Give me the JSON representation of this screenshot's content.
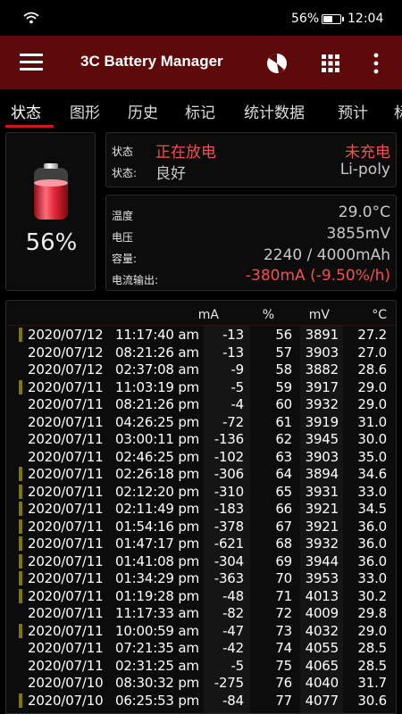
{
  "status_bar": {
    "battery_percent": "56%",
    "time": "12:04",
    "wifi_icon": "wifi-icon",
    "battery_icon": "battery-icon"
  },
  "appbar": {
    "title": "3C Battery Manager",
    "icons": [
      "menu-icon",
      "pie-chart-icon",
      "grid-icon",
      "more-vert-icon"
    ],
    "color": "#5e0a0a"
  },
  "tabs": [
    {
      "label": "状态",
      "active": true
    },
    {
      "label": "图形"
    },
    {
      "label": "历史"
    },
    {
      "label": "标记"
    },
    {
      "label": "统计数据"
    },
    {
      "label": "预计"
    },
    {
      "label": "标"
    }
  ],
  "battery": {
    "level": "56%",
    "level_fraction": 0.56,
    "icon": "battery-icon"
  },
  "state_card": {
    "status_label": "状态",
    "status_value": "正在放电",
    "charge_value": "未充电",
    "health_label": "状态:",
    "health_value": "良好",
    "chem_value": "Li-poly"
  },
  "metrics_card": {
    "temp_label": "温度",
    "temp_value": "29.0°C",
    "voltage_label": "电压",
    "voltage_value": "3855mV",
    "capacity_label": "容量:",
    "capacity_value": "2240 / 4000mAh",
    "current_label": "电流输出:",
    "current_value": "-380mA (-9.50%/h)"
  },
  "history": {
    "columns": [
      "mA",
      "%",
      "mV",
      "°C"
    ],
    "rows": [
      {
        "date": "2020/07/12",
        "time": "11:17:40 am",
        "ma": "-13",
        "pct": "56",
        "mv": "3891",
        "temp": "27.2",
        "marked": true
      },
      {
        "date": "2020/07/12",
        "time": "08:21:26 am",
        "ma": "-13",
        "pct": "57",
        "mv": "3903",
        "temp": "27.0",
        "marked": false
      },
      {
        "date": "2020/07/12",
        "time": "02:37:08 am",
        "ma": "-9",
        "pct": "58",
        "mv": "3882",
        "temp": "28.6",
        "marked": false
      },
      {
        "date": "2020/07/11",
        "time": "11:03:19 pm",
        "ma": "-5",
        "pct": "59",
        "mv": "3917",
        "temp": "29.0",
        "marked": true
      },
      {
        "date": "2020/07/11",
        "time": "08:21:26 pm",
        "ma": "-4",
        "pct": "60",
        "mv": "3932",
        "temp": "29.0",
        "marked": false
      },
      {
        "date": "2020/07/11",
        "time": "04:26:25 pm",
        "ma": "-72",
        "pct": "61",
        "mv": "3919",
        "temp": "31.0",
        "marked": false
      },
      {
        "date": "2020/07/11",
        "time": "03:00:11 pm",
        "ma": "-136",
        "pct": "62",
        "mv": "3945",
        "temp": "30.0",
        "marked": false
      },
      {
        "date": "2020/07/11",
        "time": "02:46:25 pm",
        "ma": "-102",
        "pct": "63",
        "mv": "3903",
        "temp": "35.0",
        "marked": false
      },
      {
        "date": "2020/07/11",
        "time": "02:26:18 pm",
        "ma": "-306",
        "pct": "64",
        "mv": "3894",
        "temp": "34.6",
        "marked": true
      },
      {
        "date": "2020/07/11",
        "time": "02:12:20 pm",
        "ma": "-310",
        "pct": "65",
        "mv": "3931",
        "temp": "33.0",
        "marked": true
      },
      {
        "date": "2020/07/11",
        "time": "02:11:49 pm",
        "ma": "-183",
        "pct": "66",
        "mv": "3921",
        "temp": "34.5",
        "marked": true
      },
      {
        "date": "2020/07/11",
        "time": "01:54:16 pm",
        "ma": "-378",
        "pct": "67",
        "mv": "3921",
        "temp": "36.0",
        "marked": true
      },
      {
        "date": "2020/07/11",
        "time": "01:47:17 pm",
        "ma": "-621",
        "pct": "68",
        "mv": "3932",
        "temp": "36.0",
        "marked": true
      },
      {
        "date": "2020/07/11",
        "time": "01:41:08 pm",
        "ma": "-304",
        "pct": "69",
        "mv": "3944",
        "temp": "36.0",
        "marked": true
      },
      {
        "date": "2020/07/11",
        "time": "01:34:29 pm",
        "ma": "-363",
        "pct": "70",
        "mv": "3953",
        "temp": "33.0",
        "marked": true
      },
      {
        "date": "2020/07/11",
        "time": "01:19:28 pm",
        "ma": "-48",
        "pct": "71",
        "mv": "4013",
        "temp": "30.2",
        "marked": true
      },
      {
        "date": "2020/07/11",
        "time": "11:17:33 am",
        "ma": "-82",
        "pct": "72",
        "mv": "4009",
        "temp": "29.8",
        "marked": false
      },
      {
        "date": "2020/07/11",
        "time": "10:00:59 am",
        "ma": "-47",
        "pct": "73",
        "mv": "4032",
        "temp": "29.0",
        "marked": true
      },
      {
        "date": "2020/07/11",
        "time": "07:21:35 am",
        "ma": "-42",
        "pct": "74",
        "mv": "4055",
        "temp": "28.5",
        "marked": false
      },
      {
        "date": "2020/07/11",
        "time": "02:31:25 am",
        "ma": "-5",
        "pct": "75",
        "mv": "4065",
        "temp": "28.5",
        "marked": false
      },
      {
        "date": "2020/07/10",
        "time": "08:30:32 pm",
        "ma": "-275",
        "pct": "76",
        "mv": "4040",
        "temp": "31.7",
        "marked": false
      },
      {
        "date": "2020/07/10",
        "time": "06:25:53 pm",
        "ma": "-84",
        "pct": "77",
        "mv": "4077",
        "temp": "30.6",
        "marked": true
      }
    ]
  },
  "colors": {
    "accent": "#d01616",
    "alert_text": "#f25050",
    "marker": "#7d7710"
  }
}
